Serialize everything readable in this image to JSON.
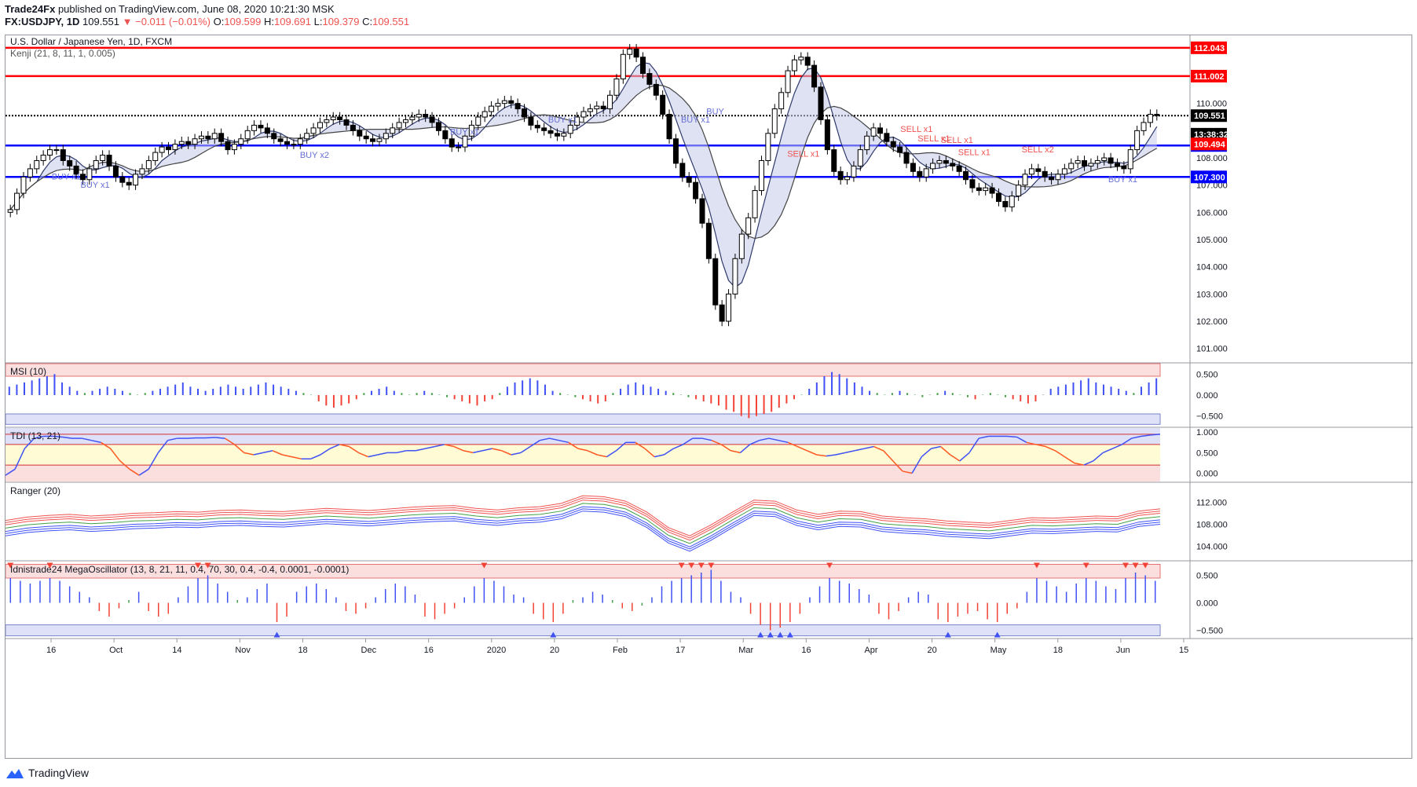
{
  "header": {
    "publisher": "Trade24Fx",
    "published_text": "published on TradingView.com, June 08, 2020 10:21:30 MSK",
    "symbol": "FX:USDJPY, 1D",
    "last": "109.551",
    "change": "−0.011 (−0.01%)",
    "o_label": "O:",
    "o": "109.599",
    "h_label": "H:",
    "h": "109.691",
    "l_label": "L:",
    "l": "109.379",
    "c_label": "C:",
    "c": "109.551"
  },
  "footer": {
    "brand": "TradingView"
  },
  "colors": {
    "up": "#ffffff",
    "down": "#000000",
    "red_line": "#ff0000",
    "blue_line": "#0000ff",
    "sell_text": "#ef5350",
    "buy_text": "#6670d6"
  },
  "chart_data": [
    {
      "type": "candlestick",
      "title": "U.S. Dollar / Japanese Yen, 1D, FXCM",
      "indicator": "Kenji (21, 8, 11, 1, 0.005)",
      "ylim": [
        100.5,
        112.5
      ],
      "y_ticks": [
        "101.000",
        "102.000",
        "103.000",
        "104.000",
        "105.000",
        "106.000",
        "107.000",
        "108.000",
        "110.000"
      ],
      "x_ticks": [
        "16",
        "Oct",
        "14",
        "Nov",
        "18",
        "Dec",
        "16",
        "2020",
        "20",
        "Feb",
        "17",
        "Mar",
        "16",
        "Apr",
        "20",
        "May",
        "18",
        "Jun",
        "15"
      ],
      "price_lines": [
        {
          "label": "112.043",
          "value": 112.043,
          "color": "#ff0000"
        },
        {
          "label": "111.002",
          "value": 111.002,
          "color": "#ff0000"
        },
        {
          "label": "109.551",
          "value": 109.551,
          "color": "#000000",
          "dotted": true
        },
        {
          "label": "108.455",
          "value": 108.455,
          "color": "#0000ff"
        },
        {
          "label": "107.300",
          "value": 107.3,
          "color": "#0000ff"
        }
      ],
      "side_labels": [
        {
          "label": "13:38:32",
          "value": 109.1,
          "color": "#000000"
        },
        {
          "label": "109.494",
          "value": 108.8,
          "color": "#ff0000"
        }
      ],
      "signals": [
        {
          "text": "BUY x1",
          "x": 0.04,
          "y": 107.2,
          "kind": "buy"
        },
        {
          "text": "BUY x1",
          "x": 0.065,
          "y": 106.9,
          "kind": "buy"
        },
        {
          "text": "BUY x2",
          "x": 0.255,
          "y": 108.0,
          "kind": "buy"
        },
        {
          "text": "BUY x1",
          "x": 0.385,
          "y": 108.85,
          "kind": "buy"
        },
        {
          "text": "BUY x1",
          "x": 0.47,
          "y": 109.3,
          "kind": "buy"
        },
        {
          "text": "BUY x1",
          "x": 0.585,
          "y": 109.3,
          "kind": "buy"
        },
        {
          "text": "BUY",
          "x": 0.607,
          "y": 109.6,
          "kind": "buy"
        },
        {
          "text": "SELL x1",
          "x": 0.677,
          "y": 108.05,
          "kind": "sell"
        },
        {
          "text": "SELL x1",
          "x": 0.775,
          "y": 108.95,
          "kind": "sell"
        },
        {
          "text": "SELL x1",
          "x": 0.79,
          "y": 108.6,
          "kind": "sell"
        },
        {
          "text": "SELL x1",
          "x": 0.81,
          "y": 108.55,
          "kind": "sell"
        },
        {
          "text": "SELL x1",
          "x": 0.825,
          "y": 108.1,
          "kind": "sell"
        },
        {
          "text": "SELL x2",
          "x": 0.88,
          "y": 108.2,
          "kind": "sell"
        },
        {
          "text": "BUY x1",
          "x": 0.955,
          "y": 107.1,
          "kind": "buy"
        }
      ],
      "series": [
        {
          "name": "price",
          "values": [
            106.1,
            106.7,
            107.3,
            107.6,
            107.9,
            108.1,
            108.3,
            108.3,
            107.9,
            107.7,
            107.4,
            107.2,
            107.6,
            107.9,
            108.1,
            107.7,
            107.3,
            107.1,
            107.0,
            107.4,
            107.6,
            107.9,
            108.2,
            108.4,
            108.3,
            108.5,
            108.6,
            108.5,
            108.7,
            108.8,
            108.7,
            108.9,
            108.6,
            108.3,
            108.5,
            108.7,
            109.0,
            109.2,
            109.1,
            108.9,
            108.7,
            108.6,
            108.5,
            108.5,
            108.7,
            108.9,
            109.1,
            109.3,
            109.4,
            109.5,
            109.4,
            109.2,
            109.0,
            108.8,
            108.7,
            108.6,
            108.7,
            108.9,
            109.1,
            109.3,
            109.4,
            109.5,
            109.6,
            109.5,
            109.3,
            109.0,
            108.7,
            108.4,
            108.4,
            108.8,
            109.2,
            109.5,
            109.7,
            109.9,
            110.0,
            110.1,
            110.0,
            109.8,
            109.5,
            109.2,
            109.1,
            109.0,
            108.9,
            108.8,
            108.9,
            109.2,
            109.5,
            109.7,
            109.8,
            109.9,
            109.8,
            110.3,
            110.9,
            111.8,
            112.0,
            111.7,
            111.1,
            110.7,
            110.3,
            109.6,
            108.7,
            107.8,
            107.3,
            107.1,
            106.5,
            105.6,
            104.3,
            102.6,
            102.0,
            103.0,
            104.3,
            105.2,
            105.8,
            106.8,
            107.9,
            108.9,
            109.8,
            110.4,
            111.2,
            111.6,
            111.7,
            111.4,
            110.6,
            109.4,
            108.3,
            107.5,
            107.2,
            107.3,
            107.7,
            108.3,
            108.8,
            109.1,
            108.9,
            108.6,
            108.4,
            108.2,
            107.8,
            107.5,
            107.3,
            107.6,
            107.8,
            107.9,
            107.8,
            107.7,
            107.5,
            107.2,
            106.9,
            106.8,
            106.9,
            106.7,
            106.4,
            106.2,
            106.6,
            107.0,
            107.4,
            107.6,
            107.5,
            107.3,
            107.2,
            107.4,
            107.6,
            107.8,
            107.9,
            107.7,
            107.8,
            107.9,
            108.0,
            107.8,
            107.7,
            107.6,
            108.3,
            109.0,
            109.3,
            109.6,
            109.55
          ]
        }
      ]
    },
    {
      "type": "histogram",
      "title": "MSI (10)",
      "ylim": [
        -0.75,
        0.75
      ],
      "y_ticks": [
        "0.500",
        "0.000",
        "−0.500"
      ],
      "series": [
        {
          "name": "MSI",
          "values": [
            0.2,
            0.25,
            0.3,
            0.35,
            0.4,
            0.45,
            0.5,
            0.3,
            0.2,
            0.1,
            0.05,
            0.1,
            0.15,
            0.2,
            0.15,
            0.1,
            0.05,
            0.0,
            0.05,
            0.1,
            0.15,
            0.2,
            0.25,
            0.3,
            0.2,
            0.15,
            0.1,
            0.15,
            0.2,
            0.25,
            0.2,
            0.15,
            0.2,
            0.25,
            0.3,
            0.25,
            0.2,
            0.15,
            0.1,
            0.05,
            0.0,
            -0.15,
            -0.25,
            -0.3,
            -0.25,
            -0.2,
            -0.1,
            0.05,
            0.1,
            0.15,
            0.2,
            0.1,
            0.05,
            0.0,
            0.05,
            0.1,
            0.05,
            0.0,
            -0.05,
            -0.1,
            -0.15,
            -0.2,
            -0.25,
            -0.15,
            -0.1,
            0.05,
            0.2,
            0.3,
            0.35,
            0.4,
            0.35,
            0.25,
            0.1,
            0.05,
            0.0,
            -0.05,
            -0.1,
            -0.15,
            -0.2,
            -0.15,
            0.05,
            0.15,
            0.25,
            0.3,
            0.25,
            0.2,
            0.15,
            0.1,
            0.05,
            0.0,
            -0.05,
            -0.1,
            -0.15,
            -0.2,
            -0.25,
            -0.35,
            -0.4,
            -0.5,
            -0.55,
            -0.5,
            -0.45,
            -0.4,
            -0.3,
            -0.2,
            -0.1,
            0.0,
            0.15,
            0.3,
            0.45,
            0.55,
            0.5,
            0.4,
            0.3,
            0.2,
            0.1,
            0.05,
            0.0,
            0.05,
            0.1,
            0.05,
            0.0,
            -0.05,
            0.0,
            0.05,
            0.1,
            0.05,
            0.0,
            -0.05,
            -0.1,
            0.0,
            0.05,
            0.0,
            -0.05,
            -0.1,
            -0.15,
            -0.2,
            -0.15,
            0.0,
            0.15,
            0.2,
            0.25,
            0.3,
            0.35,
            0.4,
            0.3,
            0.25,
            0.2,
            0.15,
            0.1,
            0.05,
            0.2,
            0.3,
            0.4
          ]
        }
      ]
    },
    {
      "type": "line",
      "title": "TDI (13, 21)",
      "ylim": [
        -0.2,
        1.1
      ],
      "y_ticks": [
        "1.000",
        "0.500",
        "0.000"
      ],
      "series": [
        {
          "name": "TDI",
          "values": [
            -0.05,
            0.1,
            0.6,
            0.85,
            0.9,
            0.9,
            0.88,
            0.85,
            0.85,
            0.8,
            0.75,
            0.6,
            0.3,
            0.1,
            -0.05,
            0.1,
            0.5,
            0.8,
            0.85,
            0.85,
            0.86,
            0.86,
            0.87,
            0.85,
            0.7,
            0.5,
            0.45,
            0.5,
            0.55,
            0.45,
            0.4,
            0.35,
            0.35,
            0.45,
            0.6,
            0.7,
            0.65,
            0.5,
            0.4,
            0.45,
            0.5,
            0.5,
            0.55,
            0.55,
            0.6,
            0.65,
            0.7,
            0.65,
            0.55,
            0.5,
            0.55,
            0.6,
            0.55,
            0.45,
            0.5,
            0.65,
            0.8,
            0.85,
            0.8,
            0.75,
            0.6,
            0.55,
            0.45,
            0.4,
            0.55,
            0.75,
            0.75,
            0.6,
            0.4,
            0.45,
            0.6,
            0.7,
            0.85,
            0.85,
            0.8,
            0.7,
            0.55,
            0.5,
            0.7,
            0.8,
            0.85,
            0.8,
            0.75,
            0.65,
            0.55,
            0.45,
            0.42,
            0.45,
            0.5,
            0.55,
            0.6,
            0.65,
            0.55,
            0.3,
            0.05,
            0.0,
            0.4,
            0.6,
            0.65,
            0.45,
            0.3,
            0.5,
            0.85,
            0.9,
            0.9,
            0.9,
            0.88,
            0.75,
            0.7,
            0.65,
            0.55,
            0.4,
            0.25,
            0.2,
            0.3,
            0.5,
            0.6,
            0.7,
            0.85,
            0.9,
            0.93,
            0.95
          ]
        }
      ]
    },
    {
      "type": "line",
      "title": "Ranger (20)",
      "ylim": [
        101.5,
        115.5
      ],
      "y_ticks": [
        "112.000",
        "108.000",
        "104.000"
      ],
      "series": [
        {
          "name": "band",
          "values": [
            107.3,
            107.9,
            108.2,
            108.4,
            108.1,
            108.3,
            108.6,
            108.7,
            108.9,
            108.8,
            109.1,
            109.2,
            109.0,
            108.9,
            109.2,
            109.5,
            109.3,
            109.1,
            109.4,
            109.7,
            109.9,
            110.0,
            109.5,
            109.2,
            109.6,
            109.8,
            110.4,
            111.8,
            111.6,
            110.8,
            108.8,
            106.0,
            104.5,
            106.5,
            108.8,
            111.0,
            110.8,
            109.2,
            108.4,
            109.0,
            108.9,
            108.1,
            107.8,
            107.6,
            107.2,
            107.0,
            106.8,
            107.3,
            107.8,
            107.7,
            107.9,
            108.1,
            108.0,
            109.0,
            109.4
          ]
        }
      ]
    },
    {
      "type": "histogram",
      "title": "Idnistrade24 MegaOscillator (13, 8, 21, 11, 0.4, 70, 30, 0.4, -0.4, 0.0001, -0.0001)",
      "ylim": [
        -0.65,
        0.75
      ],
      "y_ticks": [
        "0.500",
        "0.000",
        "−0.500"
      ],
      "series": [
        {
          "name": "MegaOsc",
          "values": [
            0.45,
            0.4,
            0.35,
            0.4,
            0.45,
            0.4,
            0.3,
            0.2,
            0.1,
            -0.15,
            -0.25,
            -0.1,
            0.05,
            0.2,
            -0.15,
            -0.25,
            -0.2,
            0.1,
            0.3,
            0.45,
            0.5,
            0.35,
            0.2,
            0.05,
            0.1,
            0.25,
            0.35,
            -0.35,
            -0.25,
            0.2,
            0.3,
            0.35,
            0.25,
            0.1,
            -0.15,
            -0.2,
            -0.1,
            0.1,
            0.25,
            0.35,
            0.3,
            0.15,
            -0.25,
            -0.3,
            -0.2,
            -0.1,
            0.1,
            0.3,
            0.45,
            0.4,
            0.3,
            0.15,
            0.1,
            -0.2,
            -0.3,
            -0.35,
            -0.2,
            0.05,
            0.1,
            0.2,
            0.15,
            0.05,
            -0.1,
            -0.15,
            -0.05,
            0.1,
            0.3,
            0.4,
            0.45,
            0.5,
            0.55,
            0.6,
            0.4,
            0.2,
            0.1,
            -0.2,
            -0.4,
            -0.5,
            -0.45,
            -0.35,
            -0.2,
            0.1,
            0.3,
            0.45,
            0.4,
            0.35,
            0.25,
            0.15,
            -0.2,
            -0.3,
            -0.15,
            0.1,
            0.2,
            0.15,
            -0.3,
            -0.35,
            -0.25,
            -0.2,
            -0.15,
            -0.3,
            -0.35,
            -0.2,
            -0.1,
            0.2,
            0.45,
            0.4,
            0.3,
            0.2,
            0.35,
            0.45,
            0.4,
            0.3,
            0.25,
            0.45,
            0.55,
            0.5,
            0.4
          ]
        }
      ]
    }
  ]
}
